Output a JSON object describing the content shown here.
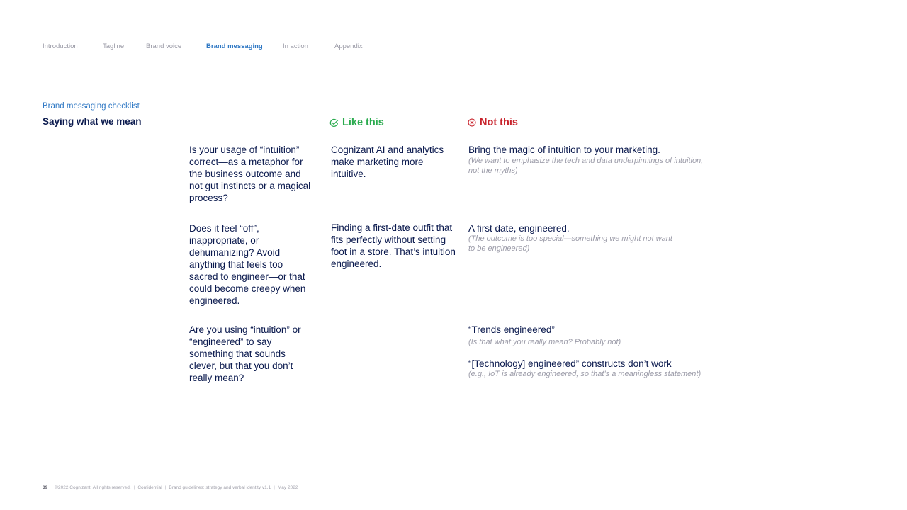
{
  "nav": {
    "items": [
      {
        "label": "Introduction",
        "active": false
      },
      {
        "label": "Tagline",
        "active": false
      },
      {
        "label": "Brand voice",
        "active": false
      },
      {
        "label": "Brand messaging",
        "active": true
      },
      {
        "label": "In action",
        "active": false
      },
      {
        "label": "Appendix",
        "active": false
      }
    ]
  },
  "header": {
    "eyebrow": "Brand messaging checklist",
    "title": "Saying what we mean"
  },
  "columns": {
    "like": {
      "label": "Like this",
      "icon": "check-circle-icon",
      "color": "#2bab4f"
    },
    "not": {
      "label": "Not this",
      "icon": "x-circle-icon",
      "color": "#c8232c"
    }
  },
  "rows": [
    {
      "question": "Is your usage of “intuition” correct—as a metaphor for the business outcome and not gut instincts or a magical process?",
      "like": "Cognizant AI and analytics make marketing more intuitive.",
      "not": [
        {
          "main": "Bring the magic of intuition to your marketing.",
          "note": "(We want to emphasize the tech and data underpinnings of intuition, not the myths)"
        }
      ]
    },
    {
      "question": "Does it feel “off”, inappropriate, or dehumanizing? Avoid anything that feels too sacred to engineer—or that could become creepy when engineered.",
      "like": "Finding a first-date outfit that fits perfectly without setting foot in a store. That’s intuition engineered.",
      "not": [
        {
          "main": "A first date, engineered.",
          "note": "(The outcome is too special—something we might not want to be engineered)"
        }
      ]
    },
    {
      "question": "Are you using “intuition” or “engineered” to say something that sounds clever, but that you don’t really mean?",
      "like": "",
      "not": [
        {
          "main": "“Trends engineered”",
          "note": "(Is that what you really mean? Probably not)"
        },
        {
          "main": "“[Technology] engineered” constructs don’t work",
          "note": "(e.g., IoT is already engineered, so that’s a meaningless statement)"
        }
      ]
    }
  ],
  "footer": {
    "page": "39",
    "copyright": "©2022 Cognizant. All rights reserved.",
    "confidential": "Confidential",
    "doc": "Brand guidelines: strategy and verbal identity v1.1",
    "date": "May 2022"
  }
}
